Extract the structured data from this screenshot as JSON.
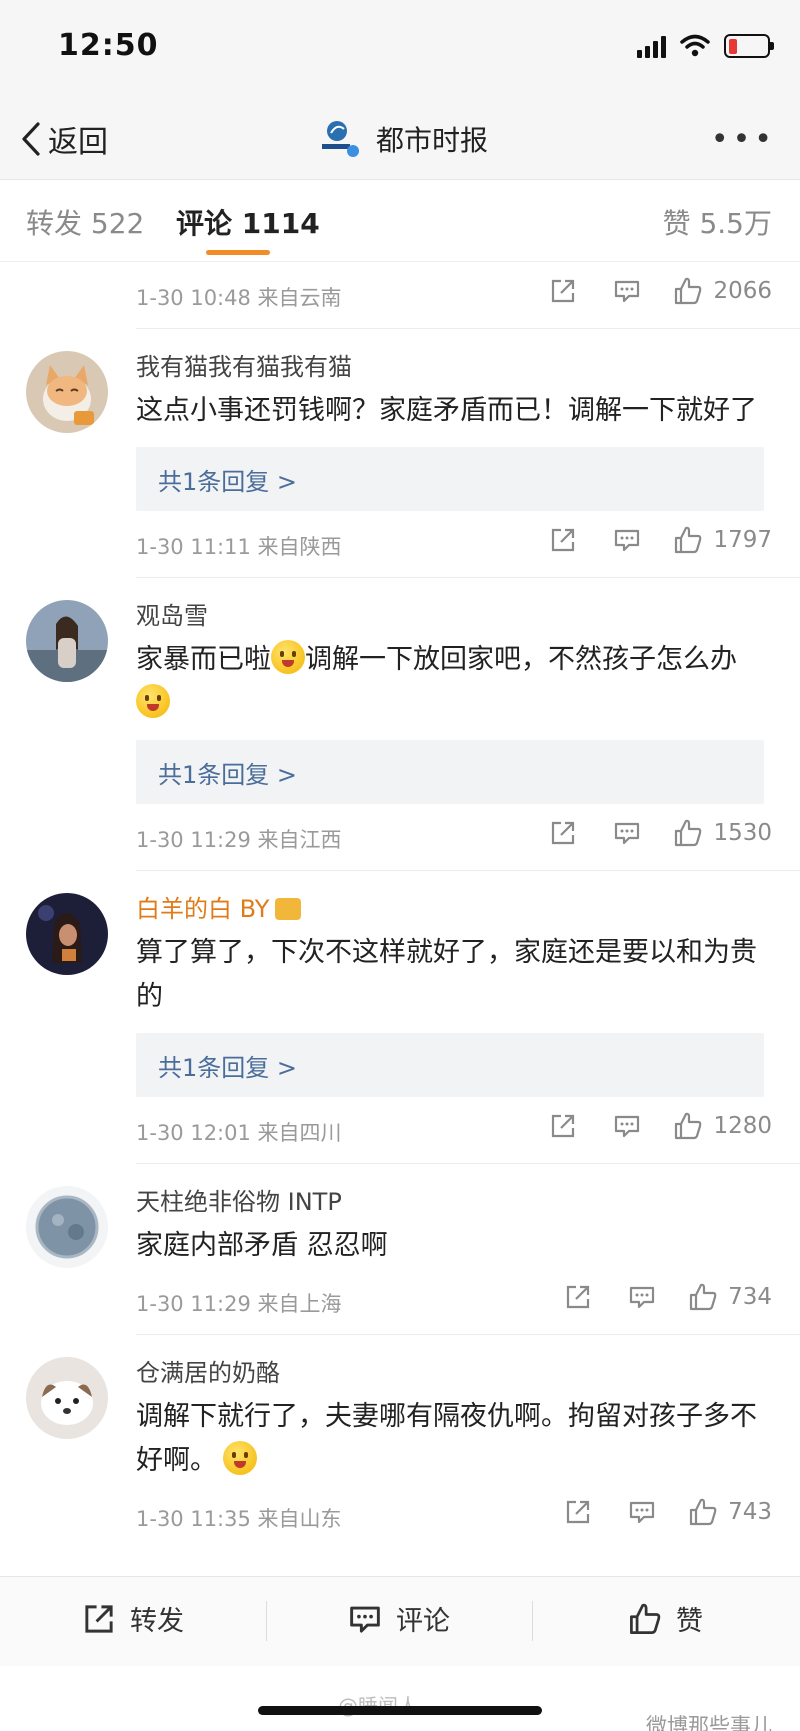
{
  "status_bar": {
    "time": "12:50"
  },
  "nav": {
    "back_label": "返回",
    "title": "都市时报"
  },
  "tabs": {
    "repost": "转发 522",
    "comments": "评论 1114",
    "likes": "赞 5.5万"
  },
  "first_meta": {
    "meta": "1-30 10:48 来自云南",
    "likes": "2066"
  },
  "comments": [
    {
      "user": "我有猫我有猫我有猫",
      "text": "这点小事还罚钱啊？家庭矛盾而已！调解一下就好了",
      "reply": "共1条回复 >",
      "meta": "1-30 11:11 来自陕西",
      "likes": "1797"
    },
    {
      "user": "观岛雪",
      "text_a": "家暴而已啦",
      "text_b": "调解一下放回家吧，不然孩子怎么办",
      "reply": "共1条回复 >",
      "meta": "1-30 11:29 来自江西",
      "likes": "1530"
    },
    {
      "user": "白羊的白 BY",
      "text": "算了算了，下次不这样就好了，家庭还是要以和为贵的",
      "reply": "共1条回复 >",
      "meta": "1-30 12:01 来自四川",
      "likes": "1280"
    },
    {
      "user": "天柱绝非俗物 INTP",
      "text": "家庭内部矛盾 忍忍啊",
      "meta": "1-30 11:29 来自上海",
      "likes": "734"
    },
    {
      "user": "仓满居的奶酪",
      "text": "调解下就行了，夫妻哪有隔夜仇啊。拘留对孩子多不好啊。",
      "meta": "1-30 11:35 来自山东",
      "likes": "743"
    }
  ],
  "bottom_bar": {
    "repost": "转发",
    "comment": "评论",
    "like": "赞"
  },
  "watermarks": {
    "center": "@睡闻人",
    "right": "微博那些事儿"
  },
  "colors": {
    "accent_orange": "#f28c28",
    "reply_blue": "#4a6d9a",
    "vip_name": "#e07b1a"
  }
}
